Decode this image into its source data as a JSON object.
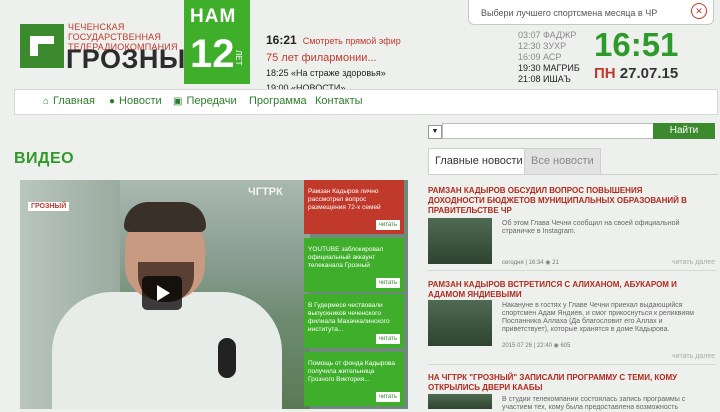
{
  "header": {
    "logo_subtitle": "ЧЕЧЕНСКАЯ ГОСУДАРСТВЕННАЯ ТЕЛЕРАДИОКОМПАНИЯ",
    "logo_title": "ГРОЗНЫЙ",
    "anniversary_top": "НАМ",
    "anniversary_num": "12",
    "anniversary_years": "ЛЕТ",
    "poll_text": "Выбери лучшего спортсмена месяца в ЧР",
    "poll_close": "✕"
  },
  "schedule": {
    "now_time": "16:21",
    "live_link": "Смотреть прямой эфир",
    "now_program": "75 лет филармонии...",
    "next1": "18:25 «На страже здоровья»",
    "next2": "19:00 «НОВОСТИ»"
  },
  "prayers": [
    "03:07 ФАДЖР",
    "12:30 ЗУХР",
    "16:09 АСР",
    "19:30 МАГРИБ",
    "21:08 ИШАЪ"
  ],
  "clock": {
    "time": "16:51",
    "dow": "ПН",
    "date": "27.07.15"
  },
  "nav": {
    "items": [
      "Главная",
      "Новости",
      "Передачи",
      "Программа",
      "Контакты"
    ]
  },
  "search": {
    "button": "Найти",
    "dropdown": "▼"
  },
  "video": {
    "section_title": "ВИДЕО",
    "channel_tag": "ГРОЗНЫЙ",
    "watermark": "ЧГТРК",
    "cards": [
      {
        "text": "Рамзан Кадыров лично рассмотрел вопрос размещения 72-х семей",
        "read": "читать"
      },
      {
        "text": "YOUTUBE заблокировал официальный аккаунт телеканала Грозный",
        "read": "читать"
      },
      {
        "text": "В Гудермесе чествовали выпускников чеченского филиала Махачкалинского института...",
        "read": "читать"
      },
      {
        "text": "Помощь от фонда Кадырова получила жительница Грозного Виктория...",
        "read": "читать"
      }
    ]
  },
  "news": {
    "tab_main": "Главные новости",
    "tab_all": "Все новости",
    "items": [
      {
        "title": "РАМЗАН КАДЫРОВ ОБСУДИЛ ВОПРОС ПОВЫШЕНИЯ ДОХОДНОСТИ БЮДЖЕТОВ МУНИЦИПАЛЬНЫХ ОБРАЗОВАНИЙ В ПРАВИТЕЛЬСТВЕ ЧР",
        "text": "Об этом Глава Чечни сообщил на своей официальной страничке в Instagram.",
        "meta": "сегодня | 16:34    ◉ 21",
        "more": "читать далее"
      },
      {
        "title": "РАМЗАН КАДЫРОВ ВСТРЕТИЛСЯ С АЛИХАНОМ, АБУКАРОМ И АДАМОМ ЯНДИЕВЫМИ",
        "text": "Накануне в гостях у Главе Чечни приехал выдающийся спортсмен Адам Яндиев, и смог прикоснуться к реликвиям Посланника Аллаха (Да благословит его Аллах и приветствует), которые хранятся в доме Кадырова.",
        "meta": "2015 07 26 | 22:40    ◉ 605",
        "more": "читать далее"
      },
      {
        "title": "НА ЧГТРК \"ГРОЗНЫЙ\" ЗАПИСАЛИ ПРОГРАММУ С ТЕМИ, КОМУ ОТКРЫЛИСЬ ДВЕРИ КААБЫ",
        "text": "В студии телекомпании состоялась запись программы с участием тех, кому была предоставлена возможность",
        "meta": "",
        "more": ""
      }
    ]
  },
  "colors": {
    "brand_green": "#3fae2a",
    "brand_red": "#c0392b"
  }
}
